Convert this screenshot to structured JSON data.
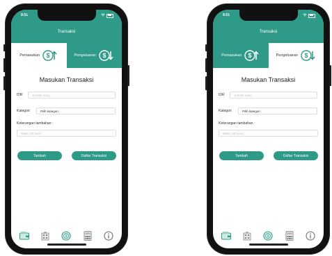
{
  "colors": {
    "brand": "#2e9a87",
    "text": "#333333",
    "placeholder": "#bbbbbb"
  },
  "screens": [
    {
      "status_time": "9:51",
      "nav_title": "Transaksi",
      "active_tab": "pemasukan",
      "tabs": [
        {
          "label": "Pemasukan",
          "icon": "dollar-arrow-up-icon"
        },
        {
          "label": "Pengeluaran",
          "icon": "dollar-arrow-down-icon"
        }
      ],
      "form": {
        "title": "Masukan Transaksi",
        "amount_label": "IDR",
        "amount_placeholder": "Jumlah uang",
        "category_label": "Kategori",
        "category_value": "Pilih kategori",
        "note_label": "Keterangan tambahan :",
        "note_placeholder": "Maks. 80 huruf"
      },
      "buttons": {
        "add": "Tambah",
        "list": "Daftar Transaksi"
      },
      "bottom_nav": [
        "wallet-icon",
        "building-icon",
        "coin-icon",
        "calculator-icon",
        "info-icon"
      ]
    },
    {
      "status_time": "9:51",
      "nav_title": "Transaksi",
      "active_tab": "pengeluaran",
      "tabs": [
        {
          "label": "Pemasukan",
          "icon": "dollar-arrow-up-icon"
        },
        {
          "label": "Pengeluaran",
          "icon": "dollar-arrow-down-icon"
        }
      ],
      "form": {
        "title": "Masukan Transaksi",
        "amount_label": "IDR",
        "amount_placeholder": "Jumlah uang",
        "category_label": "Kategori",
        "category_value": "Pilih kategori",
        "note_label": "Keterangan tambahan :",
        "note_placeholder": "Maks. 80 huruf"
      },
      "buttons": {
        "add": "Tambah",
        "list": "Daftar Transaksi"
      },
      "bottom_nav": [
        "wallet-icon",
        "building-icon",
        "coin-icon",
        "calculator-icon",
        "info-icon"
      ]
    }
  ]
}
